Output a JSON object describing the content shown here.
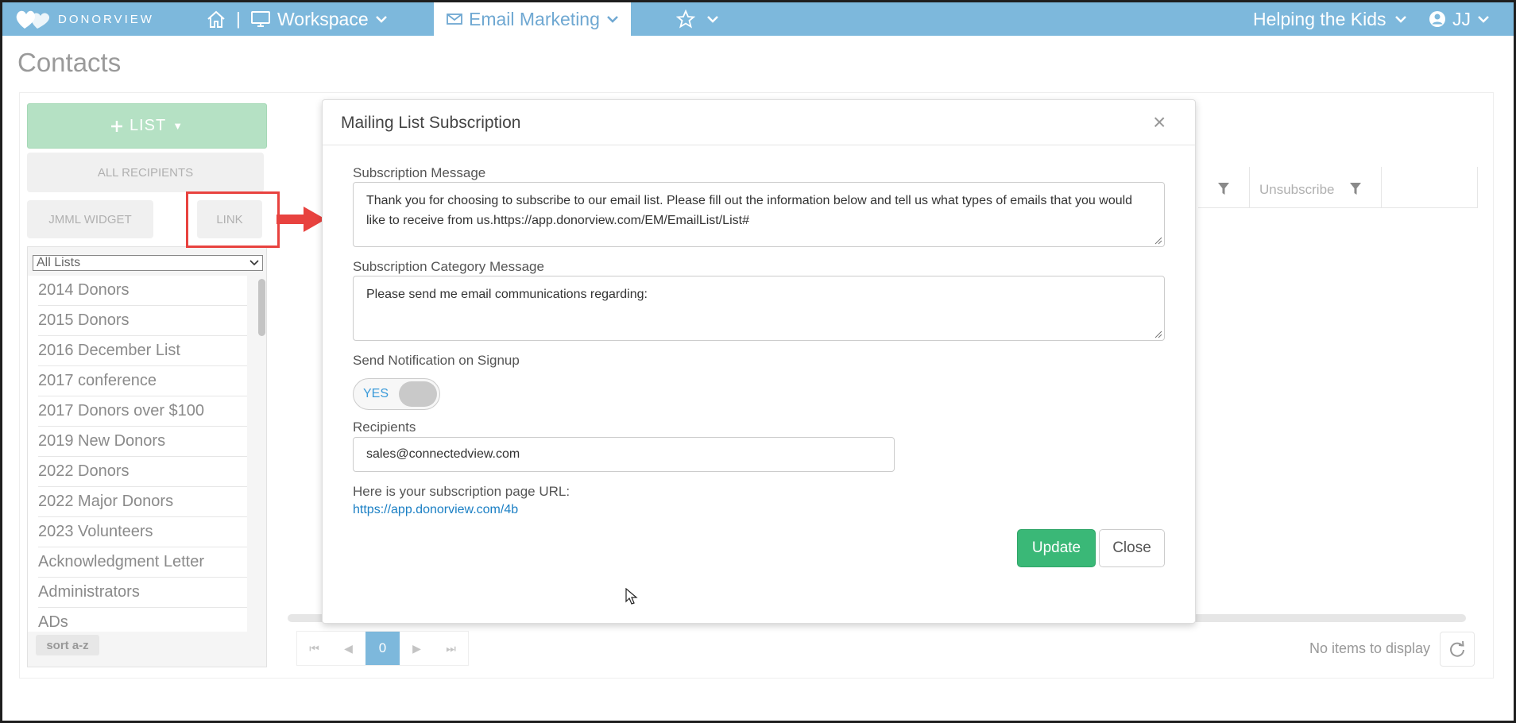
{
  "nav": {
    "logo_text": "DONORVIEW",
    "separator": "|",
    "workspace_label": "Workspace",
    "email_tab_label": "Email Marketing",
    "org_label": "Helping the Kids",
    "user_label": "JJ",
    "icons": [
      "heart-logo-icon",
      "home-icon",
      "monitor-icon",
      "envelope-icon",
      "star-icon",
      "user-circle-icon",
      "chevron-down-icon"
    ],
    "bar_color": "#7db8dc"
  },
  "page": {
    "title": "Contacts"
  },
  "left_panel": {
    "list_button_label": "LIST",
    "list_button_caret": "▼",
    "all_recipients_label": "ALL RECIPIENTS",
    "jmml_widget_label": "JMML WIDGET",
    "link_label": "LINK",
    "filter_select_value": "All Lists",
    "lists": [
      "2014 Donors",
      "2015 Donors",
      "2016 December List",
      "2017 conference",
      "2017 Donors over $100",
      "2019 New Donors",
      "2022 Donors",
      "2022 Major Donors",
      "2023 Volunteers",
      "Acknowledgment Letter",
      "Administrators",
      "ADs"
    ],
    "sort_label": "sort a-z",
    "highlight_color": "#e8423f"
  },
  "grid": {
    "unsubscribe_header": "Unsubscribe",
    "pager": {
      "first": "⏮",
      "prev": "◀",
      "current": "0",
      "next": "▶",
      "last": "⏭"
    },
    "no_items_text": "No items to display"
  },
  "modal": {
    "title": "Mailing List Subscription",
    "close_glyph": "×",
    "subscription_message_label": "Subscription Message",
    "subscription_message_value": "Thank you for choosing to subscribe to our email list. Please fill out the information below and tell us what types of emails that you would like to receive from us.https://app.donorview.com/EM/EmailList/List#",
    "category_message_label": "Subscription Category Message",
    "category_message_value": "Please send me email communications regarding:",
    "notification_label": "Send Notification on Signup",
    "notification_toggle_text": "YES",
    "recipients_label": "Recipients",
    "recipients_value": "sales@connectedview.com",
    "url_intro": "Here is your subscription page URL:",
    "url_link": "https://app.donorview.com/4b",
    "update_label": "Update",
    "close_label": "Close",
    "update_color": "#3ab877"
  }
}
